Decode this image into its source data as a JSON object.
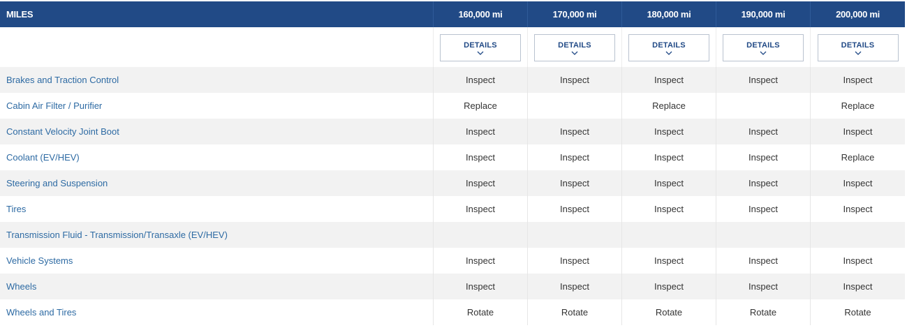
{
  "header": {
    "first_col": "MILES",
    "columns": [
      "160,000 mi",
      "170,000 mi",
      "180,000 mi",
      "190,000 mi",
      "200,000 mi"
    ]
  },
  "details_label": "DETAILS",
  "rows": [
    {
      "name": "Brakes and Traction Control",
      "values": [
        "Inspect",
        "Inspect",
        "Inspect",
        "Inspect",
        "Inspect"
      ]
    },
    {
      "name": "Cabin Air Filter / Purifier",
      "values": [
        "Replace",
        "",
        "Replace",
        "",
        "Replace"
      ]
    },
    {
      "name": "Constant Velocity Joint Boot",
      "values": [
        "Inspect",
        "Inspect",
        "Inspect",
        "Inspect",
        "Inspect"
      ]
    },
    {
      "name": "Coolant (EV/HEV)",
      "values": [
        "Inspect",
        "Inspect",
        "Inspect",
        "Inspect",
        "Replace"
      ]
    },
    {
      "name": "Steering and Suspension",
      "values": [
        "Inspect",
        "Inspect",
        "Inspect",
        "Inspect",
        "Inspect"
      ]
    },
    {
      "name": "Tires",
      "values": [
        "Inspect",
        "Inspect",
        "Inspect",
        "Inspect",
        "Inspect"
      ]
    },
    {
      "name": "Transmission Fluid - Transmission/Transaxle (EV/HEV)",
      "values": [
        "",
        "",
        "",
        "",
        ""
      ]
    },
    {
      "name": "Vehicle Systems",
      "values": [
        "Inspect",
        "Inspect",
        "Inspect",
        "Inspect",
        "Inspect"
      ]
    },
    {
      "name": "Wheels",
      "values": [
        "Inspect",
        "Inspect",
        "Inspect",
        "Inspect",
        "Inspect"
      ]
    },
    {
      "name": "Wheels and Tires",
      "values": [
        "Rotate",
        "Rotate",
        "Rotate",
        "Rotate",
        "Rotate"
      ]
    }
  ],
  "colors": {
    "header_bg": "#214a86",
    "link": "#2d6aa3",
    "stripe": "#f2f2f2"
  },
  "icons": {
    "details_toggle": "chevron-down-icon"
  }
}
